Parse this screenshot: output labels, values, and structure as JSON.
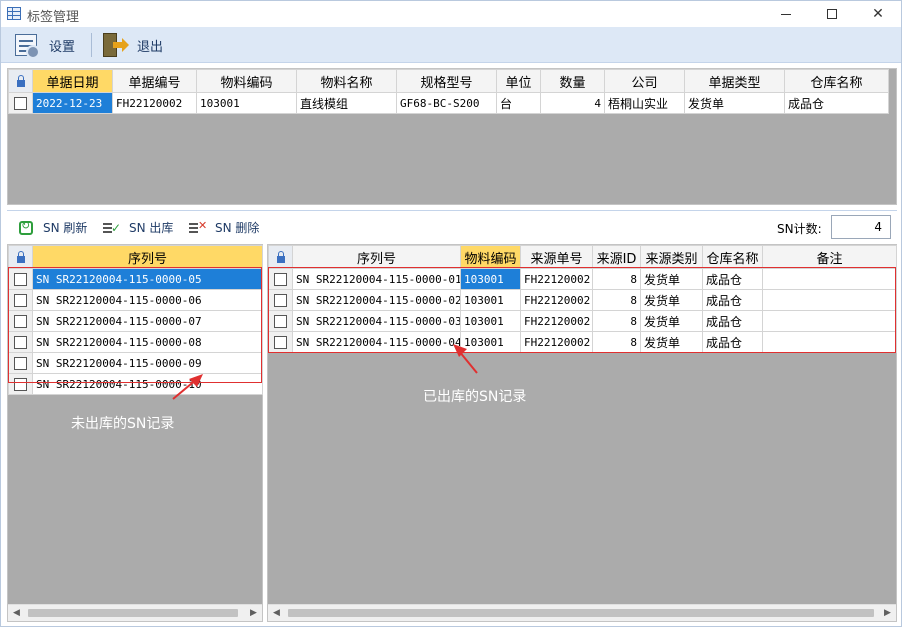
{
  "window": {
    "title": "标签管理"
  },
  "toolbar": {
    "settings_label": "设置",
    "exit_label": "退出"
  },
  "doc_grid": {
    "headers": [
      "单据日期",
      "单据编号",
      "物料编码",
      "物料名称",
      "规格型号",
      "单位",
      "数量",
      "公司",
      "单据类型",
      "仓库名称"
    ],
    "row": {
      "date": "2022-12-23",
      "doc_no": "FH22120002",
      "material_code": "103001",
      "material_name": "直线模组",
      "spec": "GF68-BC-S200",
      "unit": "台",
      "qty": "4",
      "company": "梧桐山实业",
      "doc_type": "发货单",
      "warehouse": "成品仓"
    }
  },
  "sn_toolbar": {
    "refresh_label": "SN 刷新",
    "out_label": "SN 出库",
    "delete_label": "SN 删除",
    "count_label": "SN计数:",
    "count_value": "4"
  },
  "left_grid": {
    "header": "序列号",
    "rows": [
      "SN SR22120004-115-0000-05",
      "SN SR22120004-115-0000-06",
      "SN SR22120004-115-0000-07",
      "SN SR22120004-115-0000-08",
      "SN SR22120004-115-0000-09",
      "SN SR22120004-115-0000-10"
    ],
    "annotation": "未出库的SN记录"
  },
  "right_grid": {
    "headers": [
      "序列号",
      "物料编码",
      "来源单号",
      "来源ID",
      "来源类别",
      "仓库名称",
      "备注"
    ],
    "rows": [
      {
        "sn": "SN SR22120004-115-0000-01",
        "code": "103001",
        "src_no": "FH22120002",
        "src_id": "8",
        "src_type": "发货单",
        "wh": "成品仓",
        "note": ""
      },
      {
        "sn": "SN SR22120004-115-0000-02",
        "code": "103001",
        "src_no": "FH22120002",
        "src_id": "8",
        "src_type": "发货单",
        "wh": "成品仓",
        "note": ""
      },
      {
        "sn": "SN SR22120004-115-0000-03",
        "code": "103001",
        "src_no": "FH22120002",
        "src_id": "8",
        "src_type": "发货单",
        "wh": "成品仓",
        "note": ""
      },
      {
        "sn": "SN SR22120004-115-0000-04",
        "code": "103001",
        "src_no": "FH22120002",
        "src_id": "8",
        "src_type": "发货单",
        "wh": "成品仓",
        "note": ""
      }
    ],
    "annotation": "已出库的SN记录"
  },
  "colors": {
    "selection": "#1e7fd8",
    "annotation_red": "#e03030",
    "header_highlight": "#ffd966",
    "toolbar_bg": "#dde8f6"
  }
}
